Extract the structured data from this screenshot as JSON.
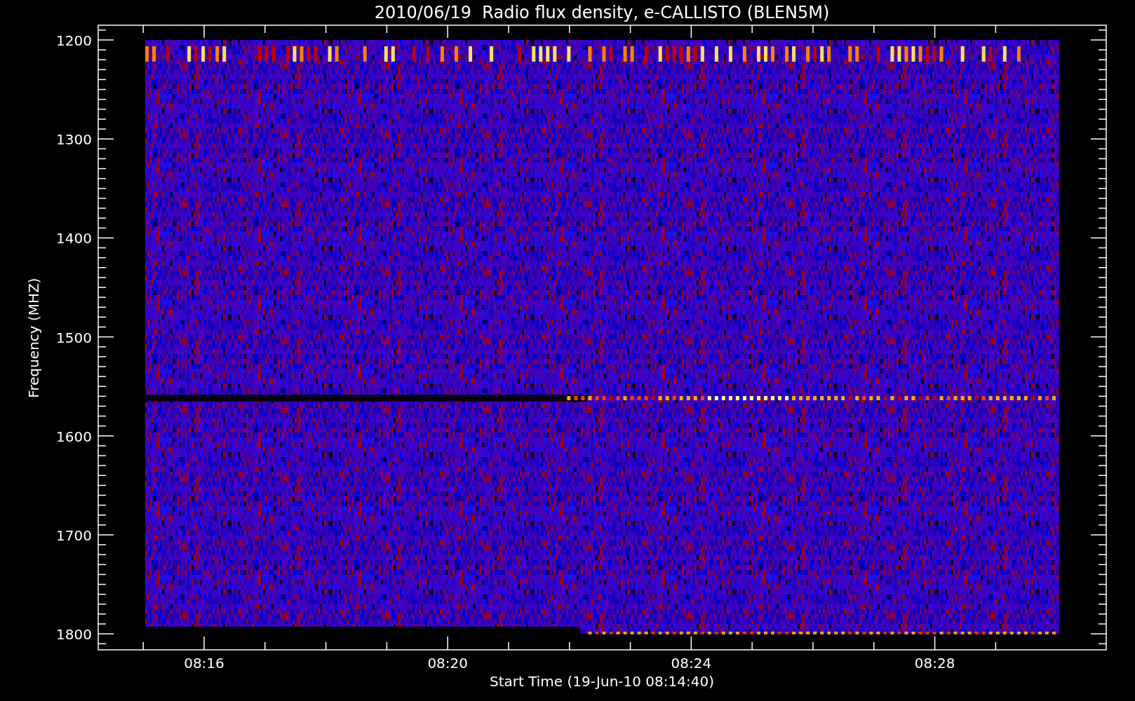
{
  "plot": {
    "title": "2010/06/19  Radio flux density, e-CALLISTO (BLEN5M)",
    "ylabel": "Frequency (MHZ)",
    "yticks": [
      "1200",
      "1300",
      "1400",
      "1500",
      "1600",
      "1700",
      "1800"
    ],
    "xlabel": "Start Time (19-Jun-10 08:14:40)",
    "xticks": [
      "08:16",
      "08:20",
      "08:24",
      "08:28"
    ]
  }
}
